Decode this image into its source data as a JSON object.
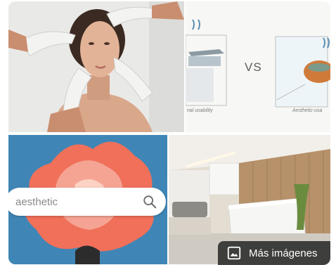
{
  "tiles": [
    {
      "name": "aesthetic face treatment photo"
    },
    {
      "name": "functional vs aesthetic illustration",
      "vs_text": "VS",
      "left_caption": "nal usability",
      "right_caption": "Aesthetic-usa"
    },
    {
      "name": "aesthetic flower search graphic",
      "search_query": "aesthetic"
    },
    {
      "name": "aesthetic clinic interior photo"
    }
  ],
  "more_images": {
    "label": "Más imágenes",
    "icon": "image-icon"
  },
  "colors": {
    "button_bg": "#2a2a2a",
    "search_bg": "#ffffff",
    "flower_bg": "#3f86b6"
  }
}
